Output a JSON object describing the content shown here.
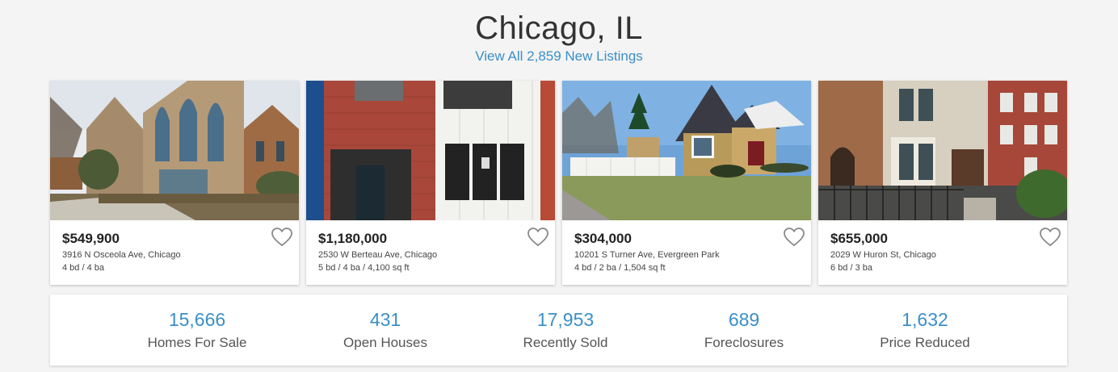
{
  "header": {
    "city": "Chicago, IL",
    "view_all": "View All 2,859 New Listings"
  },
  "listings": [
    {
      "price": "$549,900",
      "address": "3916 N Osceola Ave, Chicago",
      "specs": "4 bd  /  4 ba"
    },
    {
      "price": "$1,180,000",
      "address": "2530 W Berteau Ave, Chicago",
      "specs": "5 bd  /  4 ba  /  4,100 sq ft"
    },
    {
      "price": "$304,000",
      "address": "10201 S Turner Ave, Evergreen Park",
      "specs": "4 bd  /  2 ba  /  1,504 sq ft"
    },
    {
      "price": "$655,000",
      "address": "2029 W Huron St, Chicago",
      "specs": "6 bd  /  3 ba"
    }
  ],
  "stats": [
    {
      "value": "15,666",
      "label": "Homes For Sale"
    },
    {
      "value": "431",
      "label": "Open Houses"
    },
    {
      "value": "17,953",
      "label": "Recently Sold"
    },
    {
      "value": "689",
      "label": "Foreclosures"
    },
    {
      "value": "1,632",
      "label": "Price Reduced"
    }
  ],
  "colors": {
    "accent": "#3b8fc7",
    "background": "#f4f4f4"
  }
}
